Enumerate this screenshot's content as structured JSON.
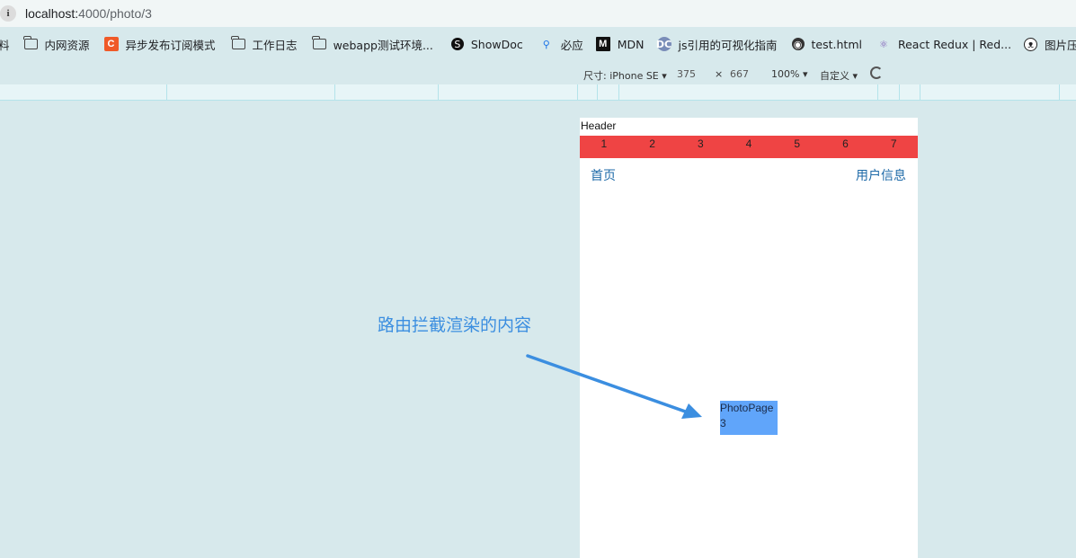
{
  "address_bar": {
    "host": "localhost:",
    "path": "4000/photo/3",
    "info_glyph": "i"
  },
  "bookmarks": [
    {
      "label": "料",
      "icon": "none"
    },
    {
      "label": "内网资源",
      "icon": "folder-icon"
    },
    {
      "label": "异步发布订阅模式",
      "icon": "c-icon",
      "glyph": "C"
    },
    {
      "label": "工作日志",
      "icon": "folder-icon"
    },
    {
      "label": "webapp测试环境...",
      "icon": "folder-icon"
    },
    {
      "label": "ShowDoc",
      "icon": "showdoc-icon",
      "glyph": "S"
    },
    {
      "label": "必应",
      "icon": "search-icon",
      "glyph": "⚲"
    },
    {
      "label": "MDN",
      "icon": "mdn-icon",
      "glyph": "M"
    },
    {
      "label": "js引用的可视化指南",
      "icon": "dc-icon",
      "glyph": "DC"
    },
    {
      "label": "test.html",
      "icon": "globe-icon",
      "glyph": "◉"
    },
    {
      "label": "React Redux | Red...",
      "icon": "redux-icon",
      "glyph": "⚛"
    },
    {
      "label": "图片压缩",
      "icon": "panda-icon",
      "glyph": "ᴥ"
    }
  ],
  "devtools": {
    "size_label": "尺寸: iPhone SE ▾",
    "width": "375",
    "times": "×",
    "height": "667",
    "zoom": "100% ▾",
    "throttle": "自定义 ▾"
  },
  "device": {
    "header": "Header",
    "tabs": [
      "1",
      "2",
      "3",
      "4",
      "5",
      "6",
      "7"
    ],
    "nav_home": "首页",
    "nav_user": "用户信息",
    "photo_title": "PhotoPage",
    "photo_id": "3"
  },
  "annotation": {
    "text": "路由拦截渲染的内容",
    "color": "#3b8ee0"
  },
  "colors": {
    "tab_bar": "#ef4444",
    "photo_box": "#60a5fa",
    "link": "#1e6aa8",
    "page_bg": "#d7e9ec"
  }
}
